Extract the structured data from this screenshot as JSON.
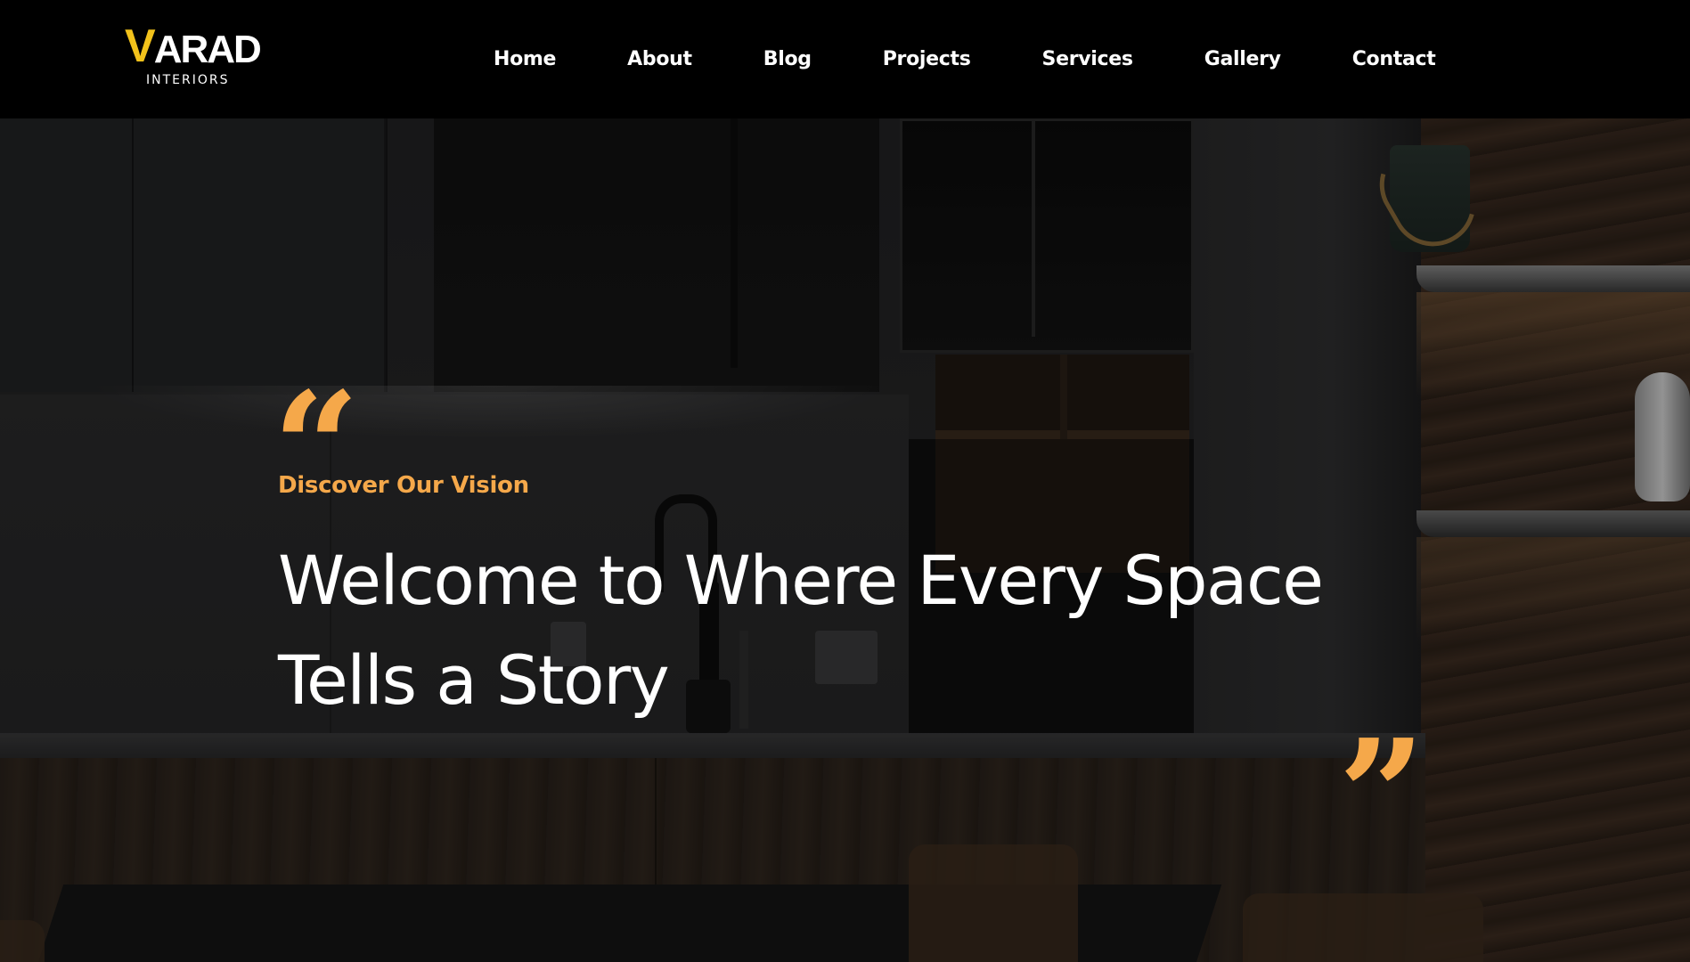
{
  "brand": {
    "logo_mark": "V",
    "logo_word": "ARAD",
    "logo_sub": "INTERIORS",
    "accent_color": "#f2c21b"
  },
  "nav": {
    "items": [
      {
        "label": "Home"
      },
      {
        "label": "About"
      },
      {
        "label": "Blog"
      },
      {
        "label": "Projects"
      },
      {
        "label": "Services"
      },
      {
        "label": "Gallery"
      },
      {
        "label": "Contact"
      }
    ]
  },
  "hero": {
    "quote_open": "“",
    "eyebrow": "Discover Our Vision",
    "headline": "Welcome to Where Every Space Tells a Story",
    "quote_close": "”",
    "quote_color": "#f5a84a"
  }
}
